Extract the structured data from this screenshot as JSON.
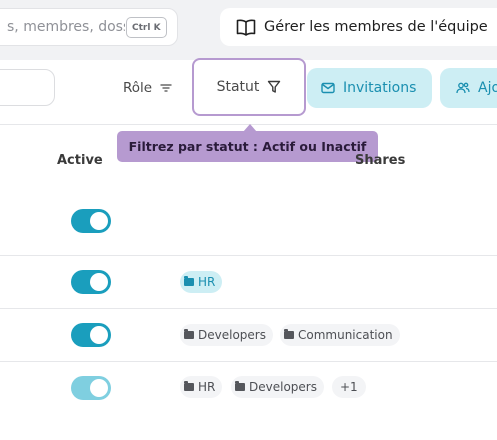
{
  "search": {
    "placeholder": "s, membres, doss",
    "shortcut": "Ctrl K"
  },
  "team": {
    "label": "Gérer les membres de l'équipe"
  },
  "filters": {
    "role_label": "Rôle",
    "statut_label": "Statut"
  },
  "actions": {
    "invitations_label": "Invitations",
    "add_label": "Ajo"
  },
  "tooltip": {
    "text": "Filtrez par statut : Actif ou Inactif"
  },
  "columns": {
    "active": "Active",
    "shares": "Shares"
  },
  "rows": [
    {
      "active": true,
      "faded": false,
      "tags": []
    },
    {
      "active": true,
      "faded": false,
      "tags": [
        {
          "label": "HR",
          "highlight": true
        }
      ]
    },
    {
      "active": true,
      "faded": false,
      "tags": [
        {
          "label": "Developers"
        },
        {
          "label": "Communication"
        }
      ]
    },
    {
      "active": true,
      "faded": true,
      "tags": [
        {
          "label": "HR"
        },
        {
          "label": "Developers"
        }
      ],
      "more": "+1"
    }
  ],
  "colors": {
    "accent": "#1a9ebd",
    "tooltip": "#b69ad0",
    "chip": "#cdeef4"
  }
}
